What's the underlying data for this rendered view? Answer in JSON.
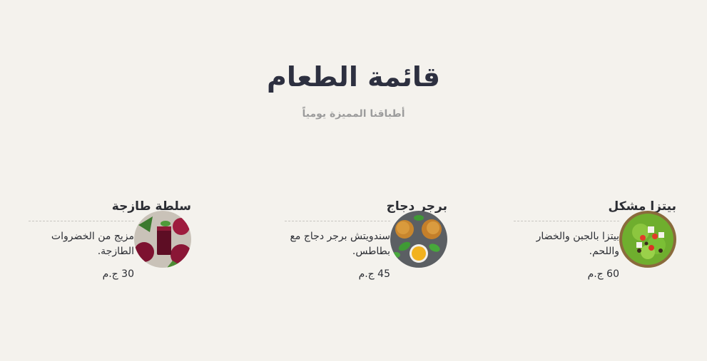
{
  "header": {
    "title": "قائمة الطعام",
    "subtitle": "أطباقنا المميزة يومياً"
  },
  "items": [
    {
      "name": "بيتزا مشكل",
      "description": "بيتزا بالجبن والخضار واللحم.",
      "price": "60 ج.م",
      "image_icon": "salad-bowl-image"
    },
    {
      "name": "برجر دجاج",
      "description": "سندويتش برجر دجاج مع بطاطس.",
      "price": "45 ج.م",
      "image_icon": "fried-chicken-image"
    },
    {
      "name": "سلطة طازجة",
      "description": "مزيج من الخضروات الطازجة.",
      "price": "30 ج.م",
      "image_icon": "beet-juice-image"
    }
  ]
}
